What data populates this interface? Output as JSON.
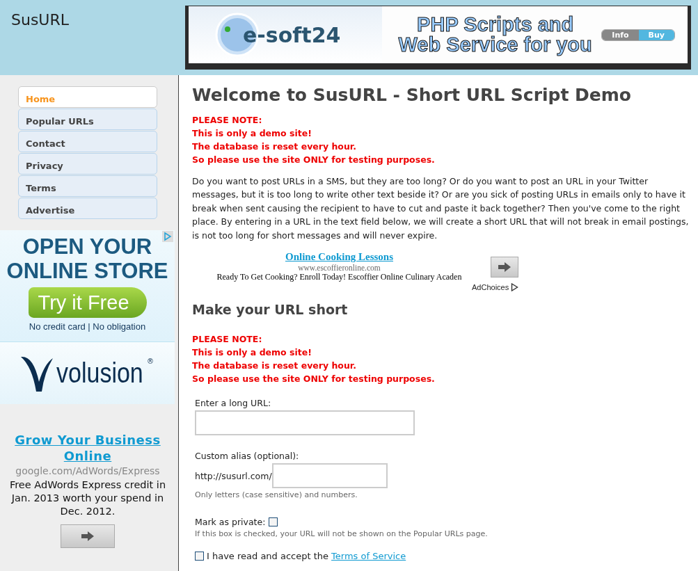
{
  "header": {
    "site_title": "SusURL",
    "banner": {
      "logo": "e-soft24",
      "headline": [
        "PHP Scripts and",
        "Web Service for you"
      ],
      "buttons": [
        {
          "label": "Info",
          "selected": false
        },
        {
          "label": "Buy",
          "selected": true
        }
      ]
    }
  },
  "sidebar": {
    "nav": [
      {
        "label": "Home",
        "selected": true
      },
      {
        "label": "Popular URLs",
        "selected": false
      },
      {
        "label": "Contact",
        "selected": false
      },
      {
        "label": "Privacy",
        "selected": false
      },
      {
        "label": "Terms",
        "selected": false
      },
      {
        "label": "Advertise",
        "selected": false
      }
    ],
    "display_ad": {
      "headline": [
        "OPEN YOUR",
        "ONLINE STORE"
      ],
      "button": "Try it Free",
      "note": "No credit card | No obligation",
      "brand": "volusion",
      "brand_mark": "®"
    },
    "text_ad": {
      "title": "Grow Your Business Online",
      "url": "google.com/AdWords/Express",
      "text": "Free AdWords Express credit in Jan. 2013 worth your spend in Dec. 2012."
    }
  },
  "main": {
    "title": "Welcome to SusURL - Short URL Script Demo",
    "notice": [
      "PLEASE NOTE:",
      "This is only a demo site!",
      "The database is reset every hour.",
      "So please use the site ONLY for testing purposes."
    ],
    "intro": "Do you want to post URLs in a SMS, but they are too long? Or do you want to post an URL in your Twitter messages, but it is too long to write other text beside it? Or are you sick of posting URLs in emails only to have it break when sent causing the recipient to have to cut and paste it back together? Then you've come to the right place. By entering in a URL in the text field below, we will create a short URL that will not break in email postings, is not too long for short messages and will never expire.",
    "ad": {
      "title": "Online Cooking Lessons",
      "url": "www.escoffieronline.com",
      "text": "Ready To Get Cooking? Enroll Today! Escoffier Online Culinary Acaden",
      "adchoices": "AdChoices"
    },
    "form_title": "Make your URL short",
    "notice_2": [
      "PLEASE NOTE:",
      "This is only a demo site!",
      "The database is reset every hour.",
      "So please use the site ONLY for testing purposes."
    ],
    "form": {
      "long_url_label": "Enter a long URL:",
      "alias_label": "Custom alias (optional):",
      "alias_prefix": "http://susurl.com/",
      "alias_hint": "Only letters (case sensitive) and numbers.",
      "private_label": "Mark as private:",
      "private_checked": false,
      "private_hint": "If this box is checked, your URL will not be shown on the Popular URLs page.",
      "terms_checked": false,
      "terms_text": "I have read and accept the",
      "terms_link": "Terms of Service"
    }
  }
}
